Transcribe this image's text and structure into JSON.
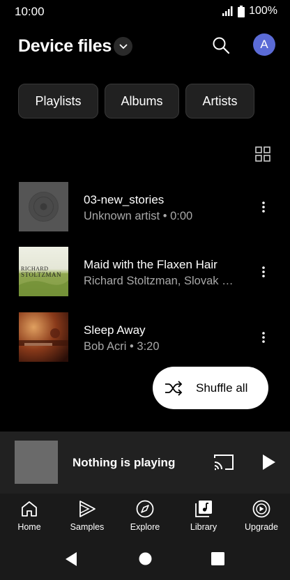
{
  "status": {
    "time": "10:00",
    "battery": "100%"
  },
  "header": {
    "title": "Device files",
    "avatar_letter": "A"
  },
  "chips": [
    "Playlists",
    "Albums",
    "Artists"
  ],
  "songs": [
    {
      "title": "03-new_stories",
      "subtitle": "Unknown artist • 0:00"
    },
    {
      "title": "Maid with the Flaxen Hair",
      "subtitle": "Richard Stoltzman, Slovak Radio Symphony Orchestra",
      "album_art_text_1": "RICHARD",
      "album_art_text_2": "STOLTZMAN"
    },
    {
      "title": "Sleep Away",
      "subtitle": "Bob Acri • 3:20"
    }
  ],
  "shuffle": {
    "label": "Shuffle all"
  },
  "mini_player": {
    "title": "Nothing is playing"
  },
  "bottom_nav": [
    {
      "label": "Home",
      "icon": "home-icon"
    },
    {
      "label": "Samples",
      "icon": "samples-icon"
    },
    {
      "label": "Explore",
      "icon": "compass-icon"
    },
    {
      "label": "Library",
      "icon": "library-icon"
    },
    {
      "label": "Upgrade",
      "icon": "upgrade-icon"
    }
  ],
  "colors": {
    "background": "#000000",
    "avatar": "#5b6bd6",
    "chip": "#212121",
    "mini_player": "#212121",
    "nav": "#1a1a1a"
  }
}
